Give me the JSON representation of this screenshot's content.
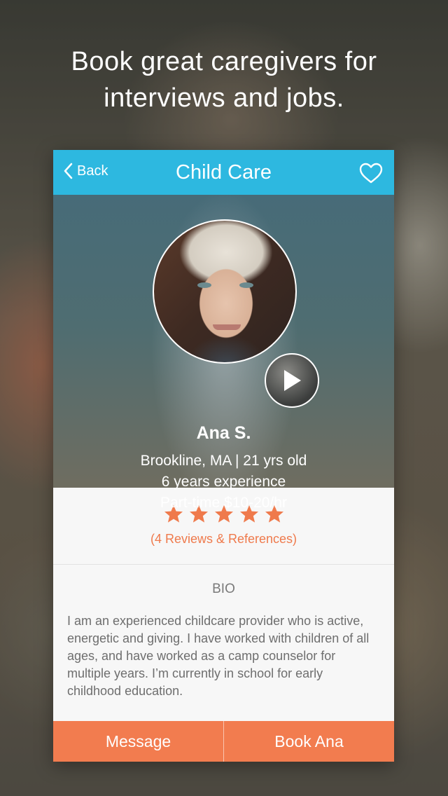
{
  "tagline": {
    "line1": "Book great caregivers for",
    "line2": "interviews and jobs."
  },
  "navbar": {
    "back_label": "Back",
    "title": "Child Care",
    "favorite_icon": "heart-outline-icon"
  },
  "profile": {
    "name": "Ana S.",
    "location_age": "Brookline, MA | 21 yrs old",
    "experience": "6 years experience",
    "rate": "Part-time $10-20/hr",
    "video_icon": "play-icon"
  },
  "rating": {
    "stars": 5,
    "max_stars": 5,
    "reviews_label": "(4 Reviews & References)"
  },
  "bio": {
    "heading": "BIO",
    "text": "I am an experienced childcare provider who is active, energetic and giving. I have worked with children of all ages, and have worked as a camp counselor for multiple years. I’m currently in school for early childhood education."
  },
  "actions": {
    "message_label": "Message",
    "book_label": "Book Ana"
  },
  "colors": {
    "navbar": "#2db8e0",
    "accent": "#f27c4f",
    "star": "#ef7a4c",
    "card_bg": "#f7f7f7"
  }
}
